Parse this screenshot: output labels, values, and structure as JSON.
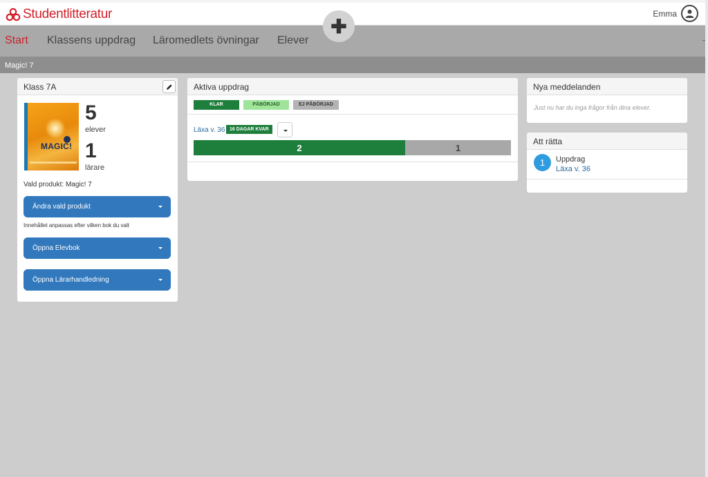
{
  "header": {
    "brand": "Studentlitteratur",
    "user_name": "Emma"
  },
  "nav": {
    "items": [
      {
        "label": "Start",
        "active": true
      },
      {
        "label": "Klassens uppdrag",
        "active": false
      },
      {
        "label": "Läromedlets övningar",
        "active": false
      },
      {
        "label": "Elever",
        "active": false
      }
    ],
    "add_symbol": "✚"
  },
  "breadcrumb": "Magic! 7",
  "class_panel": {
    "title": "Klass 7A",
    "cover_title": "MAGIC!",
    "students_count": "5",
    "students_label": "elever",
    "teachers_count": "1",
    "teachers_label": "lärare",
    "selected_product": "Vald produkt: Magic! 7",
    "change_product_label": "Ändra vald produkt",
    "content_note": "Innehållet anpassas efter vilken bok du valt",
    "open_student_book_label": "Öppna Elevbok",
    "open_teacher_guide_label": "Öppna Lärarhandledning"
  },
  "active_tasks": {
    "title": "Aktiva uppdrag",
    "legend": [
      {
        "label": "KLAR",
        "color": "#1e7e3c",
        "text_color": "#ffffff"
      },
      {
        "label": "PÅBÖRJAD",
        "color": "#9ee59a",
        "text_color": "#2b5a2b"
      },
      {
        "label": "EJ PÅBÖRJAD",
        "color": "#b3b3b3",
        "text_color": "#333333"
      }
    ],
    "task": {
      "name": "Läxa v. 36",
      "days_left": "16 DAGAR KVAR",
      "done_count": 2,
      "not_started_count": 1
    }
  },
  "messages": {
    "title": "Nya meddelanden",
    "empty_text": "Just nu har du inga frågor från dina elever."
  },
  "to_grade": {
    "title": "Att rätta",
    "count": "1",
    "item_label": "Uppdrag",
    "item_link": "Läxa v. 36"
  },
  "colors": {
    "brand_red": "#d0202b",
    "primary_blue": "#3178bd",
    "done_green": "#1e7e3c",
    "badge_blue": "#2f9be0"
  }
}
